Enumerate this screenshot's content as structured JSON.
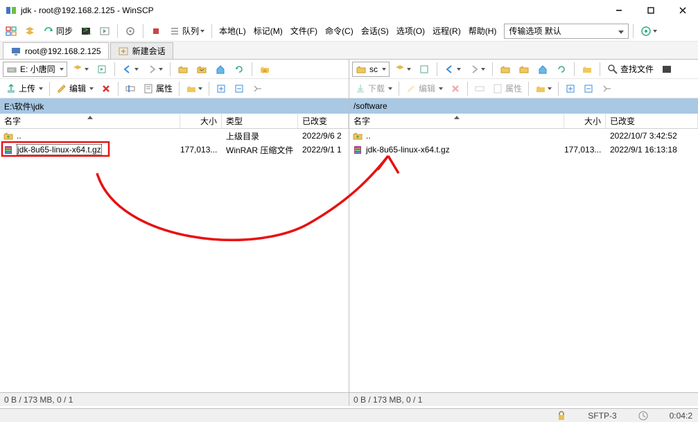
{
  "window": {
    "title": "jdk - root@192.168.2.125 - WinSCP"
  },
  "menus": {
    "sync": "同步",
    "queue": "队列",
    "local": "本地(L)",
    "mark": "标记(M)",
    "files": "文件(F)",
    "commands": "命令(C)",
    "session": "会话(S)",
    "options": "选项(O)",
    "remote": "远程(R)",
    "help": "帮助(H)",
    "transfer_label": "传输选项 默认"
  },
  "tabs": {
    "session1": "root@192.168.2.125",
    "new_session": "新建会话"
  },
  "left_pane": {
    "drive_label": "E: 小唐同",
    "upload": "上传",
    "edit": "编辑",
    "properties": "属性",
    "path": "E:\\软件\\jdk",
    "cols": {
      "name": "名字",
      "size": "大小",
      "type": "类型",
      "changed": "已改变"
    },
    "rows": [
      {
        "name": "..",
        "size": "",
        "type": "上级目录",
        "changed": "2022/9/6  2"
      },
      {
        "name": "jdk-8u65-linux-x64.t.gz",
        "size": "177,013...",
        "type": "WinRAR 压缩文件",
        "changed": "2022/9/1  1"
      }
    ],
    "status": "0 B / 173 MB,   0 / 1"
  },
  "right_pane": {
    "drive_label": "sc",
    "find": "查找文件",
    "download": "下载",
    "edit": "编辑",
    "properties": "属性",
    "path": "/software",
    "cols": {
      "name": "名字",
      "size": "大小",
      "changed": "已改变"
    },
    "rows": [
      {
        "name": "..",
        "size": "",
        "changed": "2022/10/7  3:42:52"
      },
      {
        "name": "jdk-8u65-linux-x64.t.gz",
        "size": "177,013...",
        "changed": "2022/9/1  16:13:18"
      }
    ],
    "status": "0 B / 173 MB,   0 / 1"
  },
  "bottom": {
    "protocol": "SFTP-3",
    "time": "0:04:2"
  }
}
